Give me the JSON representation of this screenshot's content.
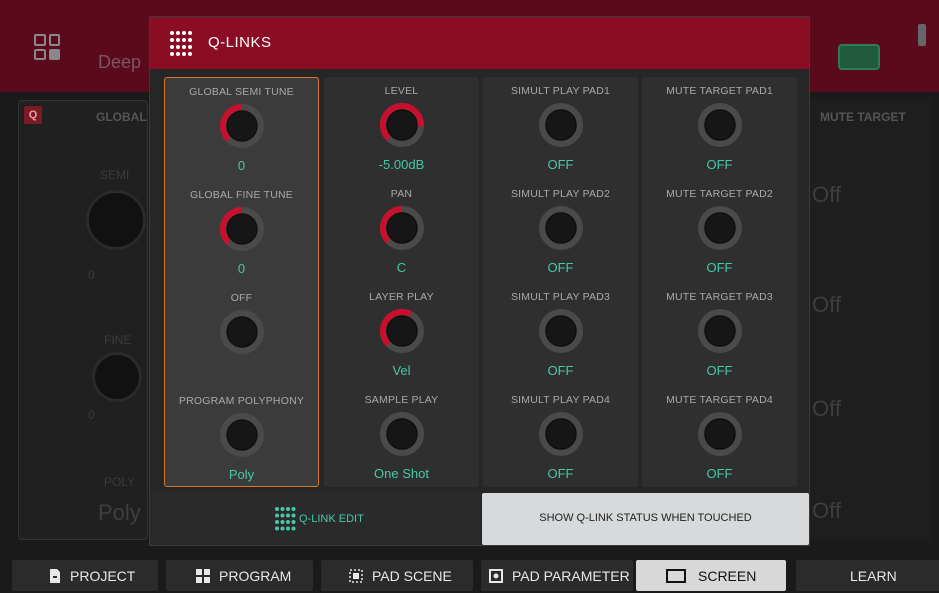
{
  "background": {
    "title": "Deep",
    "left_panel": {
      "tag": "Q",
      "header": "GLOBAL",
      "semi_label": "SEMI",
      "fine_label": "FINE",
      "poly_label": "POLY",
      "semi_value": "0",
      "fine_value": "0",
      "poly_value": "Poly"
    },
    "right_panel": {
      "header": "MUTE TARGET",
      "values": [
        "Off",
        "Off",
        "Off",
        "Off"
      ]
    }
  },
  "modal": {
    "title": "Q-LINKS",
    "columns": [
      {
        "cells": [
          {
            "label": "GLOBAL SEMI TUNE",
            "value": "0",
            "arc": 0.5
          },
          {
            "label": "GLOBAL FINE TUNE",
            "value": "0",
            "arc": 0.5
          },
          {
            "label": "OFF",
            "value": "",
            "arc": 0
          },
          {
            "label": "PROGRAM POLYPHONY",
            "value": "Poly",
            "arc": 0
          }
        ]
      },
      {
        "cells": [
          {
            "label": "LEVEL",
            "value": "-5.00dB",
            "arc": 0.85
          },
          {
            "label": "PAN",
            "value": "C",
            "arc": 0.5
          },
          {
            "label": "LAYER PLAY",
            "value": "Vel",
            "arc": 0.6
          },
          {
            "label": "SAMPLE PLAY",
            "value": "One Shot",
            "arc": 0
          }
        ]
      },
      {
        "cells": [
          {
            "label": "SIMULT PLAY PAD1",
            "value": "OFF",
            "arc": 0
          },
          {
            "label": "SIMULT PLAY PAD2",
            "value": "OFF",
            "arc": 0
          },
          {
            "label": "SIMULT PLAY PAD3",
            "value": "OFF",
            "arc": 0
          },
          {
            "label": "SIMULT PLAY PAD4",
            "value": "OFF",
            "arc": 0
          }
        ]
      },
      {
        "cells": [
          {
            "label": "MUTE TARGET PAD1",
            "value": "OFF",
            "arc": 0
          },
          {
            "label": "MUTE TARGET PAD2",
            "value": "OFF",
            "arc": 0
          },
          {
            "label": "MUTE TARGET PAD3",
            "value": "OFF",
            "arc": 0
          },
          {
            "label": "MUTE TARGET PAD4",
            "value": "OFF",
            "arc": 0
          }
        ]
      }
    ],
    "footer": {
      "qlink_edit_label": "Q-LINK EDIT",
      "show_status_label": "SHOW Q-LINK STATUS WHEN TOUCHED"
    }
  },
  "tabs": [
    {
      "label": "PROJECT",
      "icon": "project-icon",
      "active": false
    },
    {
      "label": "PROGRAM",
      "icon": "program-icon",
      "active": false
    },
    {
      "label": "PAD SCENE",
      "icon": "pad-scene-icon",
      "active": false
    },
    {
      "label": "PAD PARAMETER",
      "icon": "pad-parameter-icon",
      "active": false
    },
    {
      "label": "SCREEN",
      "icon": "screen-icon",
      "active": true
    },
    {
      "label": "LEARN",
      "icon": "",
      "active": false
    }
  ],
  "colors": {
    "accent_red": "#c8102e",
    "value_teal": "#46c8a8",
    "header_red": "#8a0d24",
    "selection_orange": "#d9732e"
  }
}
